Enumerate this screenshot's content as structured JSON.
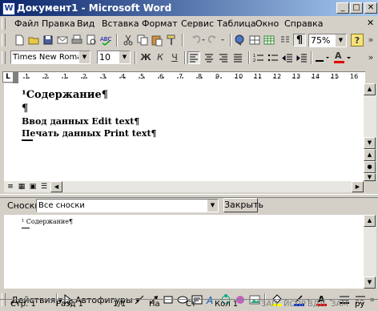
{
  "window": {
    "title": "Документ1 - Microsoft Word",
    "app_icon": "W",
    "minimize_glyph": "_",
    "maximize_glyph": "□",
    "close_glyph": "✕"
  },
  "menu": [
    "Файл",
    "Правка",
    "Вид",
    "Вставка",
    "Формат",
    "Сервис",
    "Таблица",
    "Окно",
    "Справка"
  ],
  "menu_close_glyph": "✕",
  "standard_toolbar": {
    "zoom": "75%",
    "help_glyph": "?",
    "paragraph_glyph": "¶"
  },
  "formatting_toolbar": {
    "font_name": "Times New Roman",
    "font_size": "10",
    "bold": "Ж",
    "italic": "К",
    "underline": "Ч",
    "align_left": "≡",
    "font_color_letter": "A"
  },
  "ruler": {
    "numbers": [
      "1",
      "2",
      "1",
      "2",
      "3",
      "4",
      "5",
      "6",
      "7",
      "8",
      "9",
      "10",
      "11",
      "12",
      "13",
      "14",
      "15",
      "16"
    ]
  },
  "document": {
    "lines": [
      {
        "text": "¹Содержание¶",
        "style": "heading"
      },
      {
        "text": "¶",
        "style": "heading"
      },
      {
        "text": "Ввод данных Edit text¶",
        "style": "bold"
      },
      {
        "text": "Печать данных Print text¶",
        "style": "bold"
      }
    ]
  },
  "footnote_pane": {
    "label": "Сноски",
    "selector_value": "Все сноски",
    "close_button": "Закрыть",
    "footnote_text": "¹ Содержание¶"
  },
  "drawing_toolbar": {
    "actions": "Действия",
    "autoshapes": "Автофигуры"
  },
  "status_bar": {
    "page": "Стр. 1",
    "section": "Разд 1",
    "pages": "1/1",
    "position": "На",
    "line": "Ст",
    "column": "Кол 1",
    "rec": "ЗАП",
    "trk": "ИСПР",
    "ext": "ВДЛ",
    "ovr": "ЗАМ",
    "lang": "ру"
  }
}
